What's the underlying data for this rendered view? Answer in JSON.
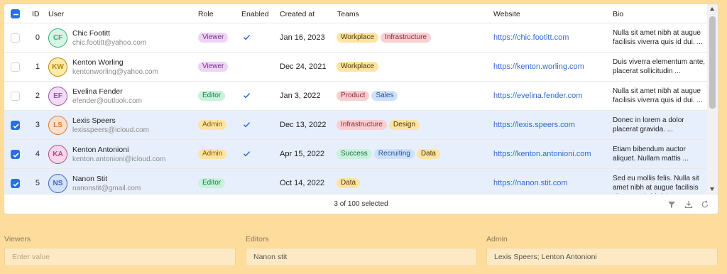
{
  "table": {
    "headers": {
      "id": "ID",
      "user": "User",
      "role": "Role",
      "enabled": "Enabled",
      "created": "Created at",
      "teams": "Teams",
      "website": "Website",
      "bio": "Bio"
    },
    "rows": [
      {
        "id": "0",
        "initials": "CF",
        "avatar_color": "#2fae74",
        "avatar_bg": "#d6f5e6",
        "name": "Chic Footitt",
        "email": "chic.footitt@yahoo.com",
        "role": "Viewer",
        "enabled": true,
        "selected": false,
        "created": "Jan 16, 2023",
        "teams": [
          "Workplace",
          "Infrastructure"
        ],
        "website": "https://chic.footitt.com",
        "bio": "Nulla sit amet nibh at augue facilisis viverra quis id dui. ..."
      },
      {
        "id": "1",
        "initials": "KW",
        "avatar_color": "#b88a00",
        "avatar_bg": "#fdeaa8",
        "name": "Kenton Worling",
        "email": "kentonworling@yahoo.com",
        "role": "Viewer",
        "enabled": false,
        "selected": false,
        "created": "Dec 24, 2021",
        "teams": [
          "Workplace"
        ],
        "website": "https://kenton.worling.com",
        "bio": "Duis viverra elementum ante, placerat sollicitudin ..."
      },
      {
        "id": "2",
        "initials": "EF",
        "avatar_color": "#9b4fb3",
        "avatar_bg": "#f1dcf6",
        "name": "Evelina Fender",
        "email": "efender@outlook.com",
        "role": "Editor",
        "enabled": true,
        "selected": false,
        "created": "Jan 3, 2022",
        "teams": [
          "Product",
          "Sales"
        ],
        "website": "https://evelina.fender.com",
        "bio": "Nulla sit amet nibh at augue facilisis viverra quis id dui. ..."
      },
      {
        "id": "3",
        "initials": "LS",
        "avatar_color": "#d57a3a",
        "avatar_bg": "#fde0cc",
        "name": "Lexis Speers",
        "email": "lexisspeers@icloud.com",
        "role": "Admin",
        "enabled": true,
        "selected": true,
        "created": "Dec 13, 2022",
        "teams": [
          "Infrastructure",
          "Design"
        ],
        "website": "https://lexis.speers.com",
        "bio": "Donec in lorem a dolor placerat gravida. ..."
      },
      {
        "id": "4",
        "initials": "KA",
        "avatar_color": "#b04a86",
        "avatar_bg": "#f7d6ea",
        "name": "Kenton Antonioni",
        "email": "kenton.antonioni@icloud.com",
        "role": "Admin",
        "enabled": true,
        "selected": true,
        "created": "Apr 15, 2022",
        "teams": [
          "Success",
          "Recruiting",
          "Data"
        ],
        "website": "https://kenton.antonioni.com",
        "bio": "Etiam bibendum auctor aliquet. Nullam mattis ..."
      },
      {
        "id": "5",
        "initials": "NS",
        "avatar_color": "#3f66b8",
        "avatar_bg": "#d3e1fb",
        "name": "Nanon Stit",
        "email": "nanonstit@gmail.com",
        "role": "Editor",
        "enabled": false,
        "selected": true,
        "created": "Oct 14, 2022",
        "teams": [
          "Data"
        ],
        "website": "https://nanon.stit.com",
        "bio": "Sed eu mollis felis. Nulla sit amet nibh at augue facilisis viverra quis id dui. ..."
      }
    ]
  },
  "footer": {
    "status": "3 of 100 selected"
  },
  "fields": {
    "viewers": {
      "label": "Viewers",
      "placeholder": "Enter value",
      "value": ""
    },
    "editors": {
      "label": "Editors",
      "value": "Nanon stit"
    },
    "admin": {
      "label": "Admin",
      "value": "Lexis Speers; Lenton Antonioni"
    }
  },
  "colors": {
    "accent": "#2a6fde",
    "background": "#fddc9c",
    "selected_row": "#e8effc",
    "link": "#2f6dd0"
  },
  "icons": {
    "header_checkbox": "indeterminate-checkbox-icon",
    "enabled": "checkmark-icon",
    "footer": [
      "filter-icon",
      "download-icon",
      "refresh-icon"
    ]
  }
}
